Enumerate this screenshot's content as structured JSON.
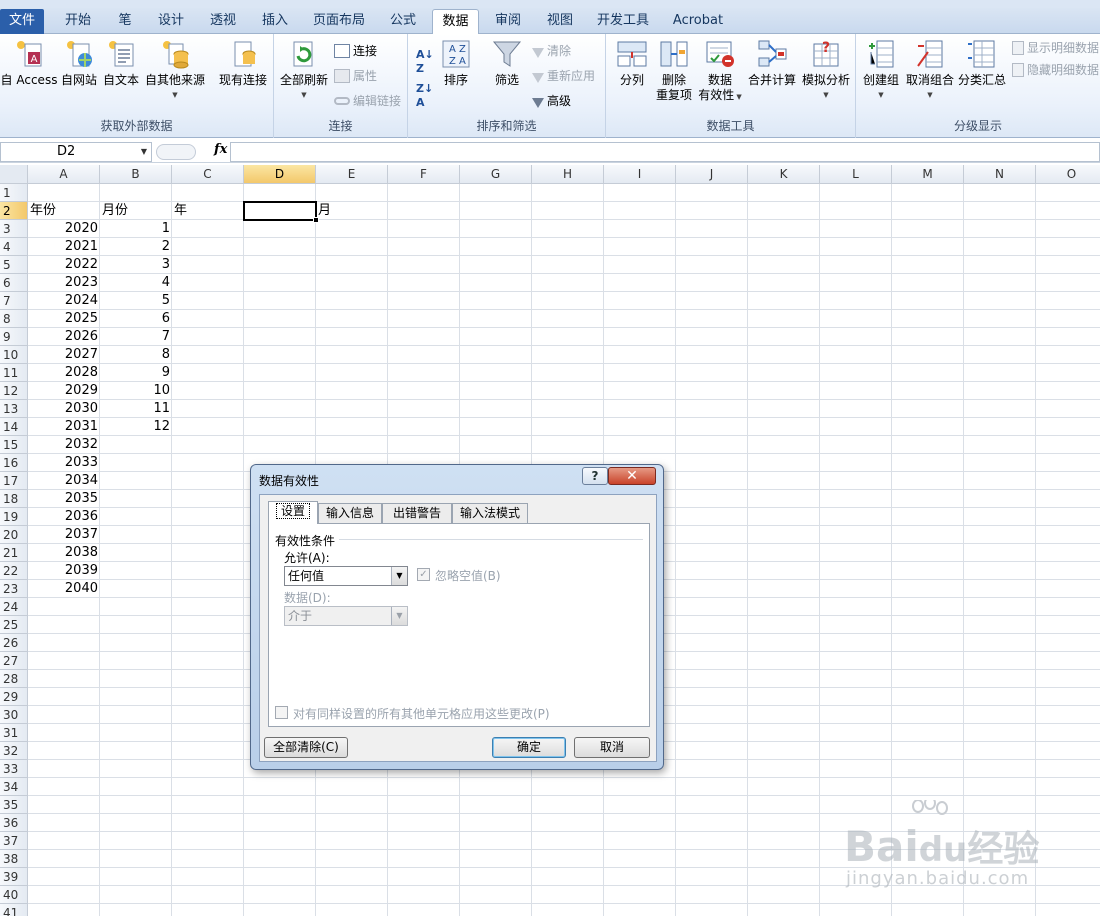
{
  "tabs": [
    "文件",
    "开始",
    "笔",
    "设计",
    "透视",
    "插入",
    "页面布局",
    "公式",
    "数据",
    "审阅",
    "视图",
    "开发工具",
    "Acrobat"
  ],
  "active_tab": "数据",
  "ribbon": {
    "external": {
      "label": "获取外部数据",
      "access": "自 Access",
      "web": "自网站",
      "text": "自文本",
      "other": "自其他来源",
      "existing": "现有连接"
    },
    "connections": {
      "label": "连接",
      "refresh_all": "全部刷新",
      "connections": "连接",
      "properties": "属性",
      "edit_links": "编辑链接"
    },
    "sort_filter": {
      "label": "排序和筛选",
      "sort": "排序",
      "filter": "筛选",
      "clear": "清除",
      "reapply": "重新应用",
      "advanced": "高级"
    },
    "data_tools": {
      "label": "数据工具",
      "text_to_columns": "分列",
      "remove_dup_1": "删除",
      "remove_dup_2": "重复项",
      "validation_1": "数据",
      "validation_2": "有效性",
      "consolidate": "合并计算",
      "whatif": "模拟分析"
    },
    "outline": {
      "label": "分级显示",
      "group": "创建组",
      "ungroup": "取消组合",
      "subtotal": "分类汇总",
      "show_detail": "显示明细数据",
      "hide_detail": "隐藏明细数据"
    }
  },
  "formula_bar": {
    "name_box": "D2",
    "fx": "fx",
    "value": ""
  },
  "columns": [
    "A",
    "B",
    "C",
    "D",
    "E",
    "F",
    "G",
    "H",
    "I",
    "J",
    "K",
    "L",
    "M",
    "N",
    "O"
  ],
  "selected_column": "D",
  "rows": [
    "1",
    "2",
    "3",
    "4",
    "5",
    "6",
    "7",
    "8",
    "9",
    "10",
    "11",
    "12",
    "13",
    "14",
    "15",
    "16",
    "17",
    "18",
    "19",
    "20",
    "21",
    "22",
    "23",
    "24",
    "25",
    "26",
    "27",
    "28",
    "29",
    "30",
    "31",
    "32",
    "33",
    "34",
    "35",
    "36",
    "37",
    "38",
    "39",
    "40",
    "41"
  ],
  "selected_row": "2",
  "sheet": {
    "headers": {
      "A": "年份",
      "B": "月份",
      "C": "年",
      "E": "月"
    },
    "years": [
      "2020",
      "2021",
      "2022",
      "2023",
      "2024",
      "2025",
      "2026",
      "2027",
      "2028",
      "2029",
      "2030",
      "2031",
      "2032",
      "2033",
      "2034",
      "2035",
      "2036",
      "2037",
      "2038",
      "2039",
      "2040"
    ],
    "months": [
      "1",
      "2",
      "3",
      "4",
      "5",
      "6",
      "7",
      "8",
      "9",
      "10",
      "11",
      "12"
    ]
  },
  "dialog": {
    "title": "数据有效性",
    "help": "?",
    "close": "✕",
    "tabs": [
      "设置",
      "输入信息",
      "出错警告",
      "输入法模式"
    ],
    "section": "有效性条件",
    "allow_label": "允许(A):",
    "allow_value": "任何值",
    "ignore_blank": "忽略空值(B)",
    "data_label": "数据(D):",
    "data_value": "介于",
    "apply_all": "对有同样设置的所有其他单元格应用这些更改(P)",
    "clear_all": "全部清除(C)",
    "ok": "确定",
    "cancel": "取消"
  },
  "watermark": {
    "brand": "Bai",
    "brand2": "du",
    "cn": "经验",
    "url": "jingyan.baidu.com"
  },
  "colors": {
    "file_tab": "#2b5faa",
    "selected_header": "#f3c86b",
    "dialog_frame": "#b9cfe9",
    "close_button": "#c9432a"
  }
}
